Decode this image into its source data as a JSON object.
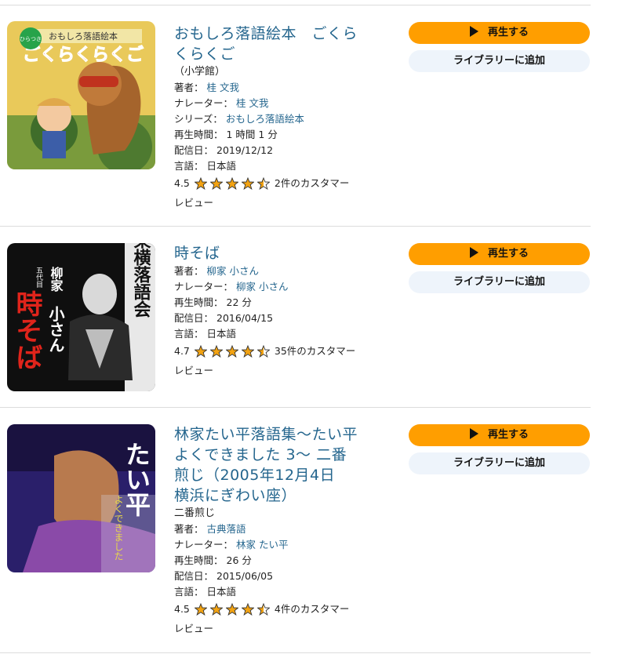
{
  "labels": {
    "author": "著者：",
    "narrator": "ナレーター：",
    "series": "シリーズ：",
    "runtime": "再生時間：",
    "release": "配信日：",
    "language": "言語："
  },
  "buttons": {
    "play": "再生する",
    "library": "ライブラリーに追加"
  },
  "items": [
    {
      "title": "おもしろ落語絵本　ごくらくらくご",
      "publisher": "（小学館）",
      "author": "桂 文我",
      "narrator": "桂 文我",
      "series": "おもしろ落語絵本",
      "runtime": "1 時間 1 分",
      "release": "2019/12/12",
      "language": "日本語",
      "rating": "4.5",
      "stars": 4.5,
      "reviews": "2件のカスタマーレビュー",
      "cover": {
        "badge": "ひらつき",
        "top": "おもしろ落語絵本",
        "main": "ごくらくらくご"
      }
    },
    {
      "title": "時そば",
      "author": "柳家 小さん",
      "narrator": "柳家 小さん",
      "runtime": "22 分",
      "release": "2016/04/15",
      "language": "日本語",
      "rating": "4.7",
      "stars": 4.5,
      "reviews": "35件のカスタマーレビュー",
      "cover": {
        "small": "五代目",
        "name1": "柳家",
        "name2": "小さん",
        "main": "時そば",
        "side": "東横落語会"
      }
    },
    {
      "title": "林家たい平落語集〜たい平よくできました 3〜 二番煎じ（2005年12月4日　横浜にぎわい座）",
      "subtitle": "二番煎じ",
      "author": "古典落語",
      "narrator": "林家 たい平",
      "runtime": "26 分",
      "release": "2015/06/05",
      "language": "日本語",
      "rating": "4.5",
      "stars": 4.5,
      "reviews": "4件のカスタマーレビュー",
      "cover": {
        "main": "たい平",
        "side": "よくできました"
      }
    }
  ],
  "colors": {
    "link": "#25668e",
    "play": "#ff9e00",
    "library": "#eef4fb",
    "star": "#f3a312"
  }
}
